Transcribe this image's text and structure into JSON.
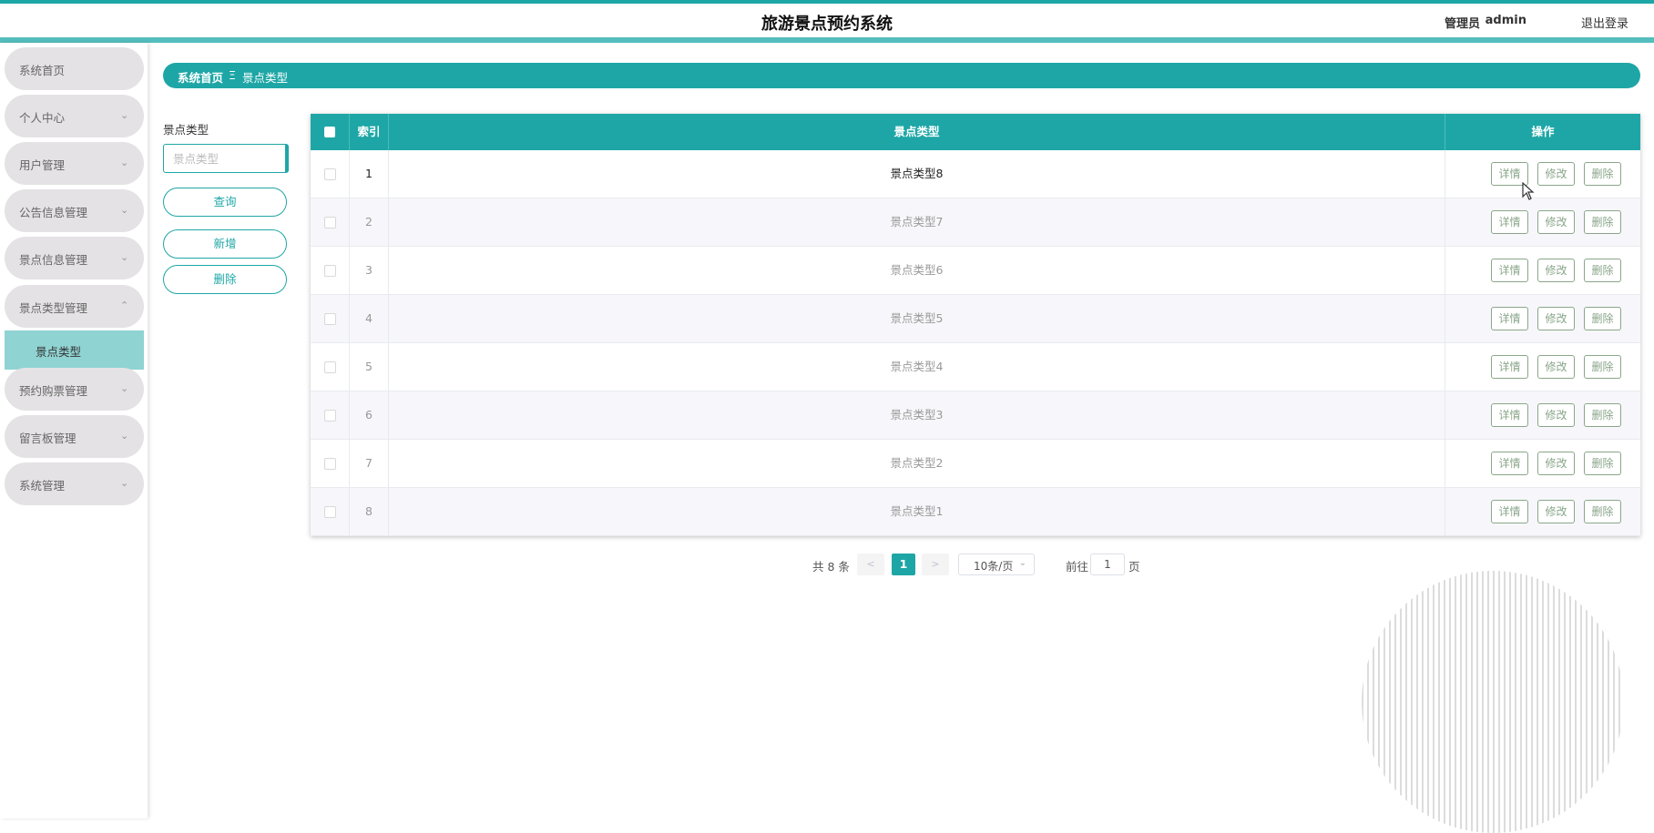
{
  "header": {
    "title": "旅游景点预约系统",
    "admin_label": "管理员",
    "admin_name": "admin",
    "logout": "退出登录"
  },
  "sidebar": {
    "items": [
      {
        "label": "系统首页",
        "has_chevron": false
      },
      {
        "label": "个人中心",
        "has_chevron": true
      },
      {
        "label": "用户管理",
        "has_chevron": true
      },
      {
        "label": "公告信息管理",
        "has_chevron": true
      },
      {
        "label": "景点信息管理",
        "has_chevron": true
      },
      {
        "label": "景点类型管理",
        "has_chevron": true,
        "expanded": true
      },
      {
        "label": "预约购票管理",
        "has_chevron": true
      },
      {
        "label": "留言板管理",
        "has_chevron": true
      },
      {
        "label": "系统管理",
        "has_chevron": true
      }
    ],
    "active_subitem": "景点类型"
  },
  "breadcrumb": {
    "home": "系统首页",
    "separator": "Ξ",
    "current": "景点类型"
  },
  "search": {
    "label": "景点类型",
    "placeholder": "景点类型",
    "query_button": "查询",
    "add_button": "新增",
    "delete_button": "删除"
  },
  "table": {
    "headers": [
      "索引",
      "景点类型",
      "操作"
    ],
    "actions": [
      "详情",
      "修改",
      "删除"
    ],
    "rows": [
      {
        "index": "1",
        "type": "景点类型8"
      },
      {
        "index": "2",
        "type": "景点类型7"
      },
      {
        "index": "3",
        "type": "景点类型6"
      },
      {
        "index": "4",
        "type": "景点类型5"
      },
      {
        "index": "5",
        "type": "景点类型4"
      },
      {
        "index": "6",
        "type": "景点类型3"
      },
      {
        "index": "7",
        "type": "景点类型2"
      },
      {
        "index": "8",
        "type": "景点类型1"
      }
    ]
  },
  "pagination": {
    "total": "共 8 条",
    "prev": "<",
    "current_page": "1",
    "next": ">",
    "page_size": "10条/页",
    "goto_label": "前往",
    "goto_value": "1",
    "goto_suffix": "页"
  },
  "colors": {
    "accent": "#1ea6a6",
    "submenu_active": "#90d3d3",
    "menu_bg": "#e4e2e4",
    "action_border": "#8aa68a"
  }
}
